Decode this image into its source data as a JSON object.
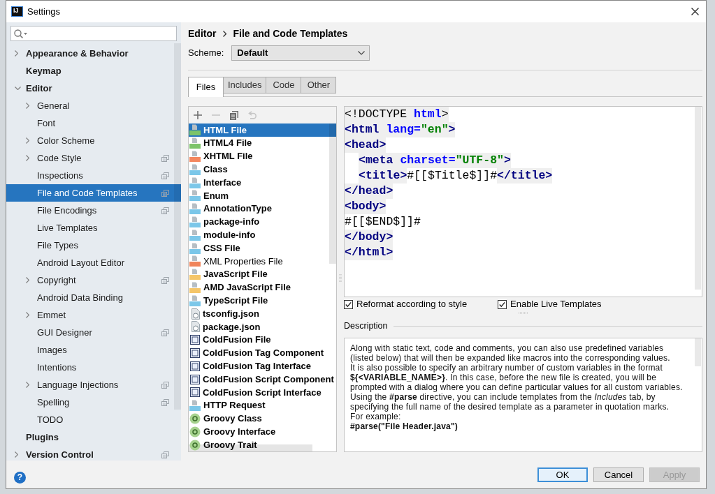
{
  "window": {
    "title": "Settings",
    "logo": "IJ"
  },
  "sidebar": {
    "items": [
      {
        "label": "Appearance & Behavior",
        "kind": "group",
        "expanded": false,
        "selected": false,
        "project_level": false
      },
      {
        "label": "Keymap",
        "kind": "leaf",
        "selected": false,
        "project_level": false
      },
      {
        "label": "Editor",
        "kind": "group",
        "expanded": true,
        "selected": false,
        "project_level": false,
        "children": [
          {
            "label": "General",
            "kind": "group",
            "expanded": false,
            "selected": false,
            "project_level": false
          },
          {
            "label": "Font",
            "kind": "leaf",
            "selected": false,
            "project_level": false
          },
          {
            "label": "Color Scheme",
            "kind": "group",
            "expanded": false,
            "selected": false,
            "project_level": false
          },
          {
            "label": "Code Style",
            "kind": "group",
            "expanded": false,
            "selected": false,
            "project_level": true
          },
          {
            "label": "Inspections",
            "kind": "leaf",
            "selected": false,
            "project_level": true
          },
          {
            "label": "File and Code Templates",
            "kind": "leaf",
            "selected": true,
            "project_level": true
          },
          {
            "label": "File Encodings",
            "kind": "leaf",
            "selected": false,
            "project_level": true
          },
          {
            "label": "Live Templates",
            "kind": "leaf",
            "selected": false,
            "project_level": false
          },
          {
            "label": "File Types",
            "kind": "leaf",
            "selected": false,
            "project_level": false
          },
          {
            "label": "Android Layout Editor",
            "kind": "leaf",
            "selected": false,
            "project_level": false
          },
          {
            "label": "Copyright",
            "kind": "group",
            "expanded": false,
            "selected": false,
            "project_level": true
          },
          {
            "label": "Android Data Binding",
            "kind": "leaf",
            "selected": false,
            "project_level": false
          },
          {
            "label": "Emmet",
            "kind": "group",
            "expanded": false,
            "selected": false,
            "project_level": false
          },
          {
            "label": "GUI Designer",
            "kind": "leaf",
            "selected": false,
            "project_level": true
          },
          {
            "label": "Images",
            "kind": "leaf",
            "selected": false,
            "project_level": false
          },
          {
            "label": "Intentions",
            "kind": "leaf",
            "selected": false,
            "project_level": false
          },
          {
            "label": "Language Injections",
            "kind": "group",
            "expanded": false,
            "selected": false,
            "project_level": true
          },
          {
            "label": "Spelling",
            "kind": "leaf",
            "selected": false,
            "project_level": true
          },
          {
            "label": "TODO",
            "kind": "leaf",
            "selected": false,
            "project_level": false
          }
        ]
      },
      {
        "label": "Plugins",
        "kind": "leaf",
        "selected": false,
        "project_level": false
      },
      {
        "label": "Version Control",
        "kind": "group",
        "expanded": false,
        "selected": false,
        "project_level": true
      }
    ]
  },
  "breadcrumb": [
    "Editor",
    "File and Code Templates"
  ],
  "scheme": {
    "label": "Scheme:",
    "value": "Default"
  },
  "tabs": [
    {
      "label": "Files",
      "selected": true
    },
    {
      "label": "Includes",
      "selected": false
    },
    {
      "label": "Code",
      "selected": false
    },
    {
      "label": "Other",
      "selected": false
    }
  ],
  "file_list": {
    "toolbar": [
      {
        "kind": "add",
        "disabled": false
      },
      {
        "kind": "remove",
        "disabled": true
      },
      {
        "kind": "copy",
        "disabled": false
      },
      {
        "kind": "reset",
        "disabled": true
      }
    ],
    "items": [
      {
        "label": "HTML File",
        "kind": "html",
        "bold": true,
        "selected": true
      },
      {
        "label": "HTML4 File",
        "kind": "html",
        "bold": true,
        "selected": false
      },
      {
        "label": "XHTML File",
        "kind": "xhtml",
        "bold": true,
        "selected": false
      },
      {
        "label": "Class",
        "kind": "java",
        "bold": true,
        "selected": false
      },
      {
        "label": "Interface",
        "kind": "java",
        "bold": true,
        "selected": false
      },
      {
        "label": "Enum",
        "kind": "java",
        "bold": true,
        "selected": false
      },
      {
        "label": "AnnotationType",
        "kind": "java",
        "bold": true,
        "selected": false
      },
      {
        "label": "package-info",
        "kind": "java",
        "bold": true,
        "selected": false
      },
      {
        "label": "module-info",
        "kind": "java",
        "bold": true,
        "selected": false
      },
      {
        "label": "CSS File",
        "kind": "css",
        "bold": true,
        "selected": false
      },
      {
        "label": "XML Properties File",
        "kind": "xml",
        "bold": false,
        "selected": false
      },
      {
        "label": "JavaScript File",
        "kind": "js",
        "bold": true,
        "selected": false
      },
      {
        "label": "AMD JavaScript File",
        "kind": "js",
        "bold": true,
        "selected": false
      },
      {
        "label": "TypeScript File",
        "kind": "ts",
        "bold": true,
        "selected": false
      },
      {
        "label": "tsconfig.json",
        "kind": "json",
        "bold": true,
        "selected": false
      },
      {
        "label": "package.json",
        "kind": "json",
        "bold": true,
        "selected": false
      },
      {
        "label": "ColdFusion File",
        "kind": "cf",
        "bold": true,
        "selected": false
      },
      {
        "label": "ColdFusion Tag Component",
        "kind": "cf",
        "bold": true,
        "selected": false
      },
      {
        "label": "ColdFusion Tag Interface",
        "kind": "cf",
        "bold": true,
        "selected": false
      },
      {
        "label": "ColdFusion Script Component",
        "kind": "cf",
        "bold": true,
        "selected": false
      },
      {
        "label": "ColdFusion Script Interface",
        "kind": "cf",
        "bold": true,
        "selected": false
      },
      {
        "label": "HTTP Request",
        "kind": "api",
        "bold": true,
        "selected": false
      },
      {
        "label": "Groovy Class",
        "kind": "groovy",
        "bold": true,
        "selected": false
      },
      {
        "label": "Groovy Interface",
        "kind": "groovy",
        "bold": true,
        "selected": false
      },
      {
        "label": "Groovy Trait",
        "kind": "groovy",
        "bold": true,
        "selected": false
      }
    ]
  },
  "editor": {
    "lines": [
      {
        "tokens": [
          {
            "text": "<!DOCTYPE ",
            "kind": "markup"
          },
          {
            "text": "html",
            "kind": "attr"
          },
          {
            "text": ">",
            "kind": "markup"
          }
        ]
      },
      {
        "tokens": [
          {
            "text": "<html ",
            "kind": "tag"
          },
          {
            "text": "lang=",
            "kind": "attr"
          },
          {
            "text": "\"en\"",
            "kind": "value"
          },
          {
            "text": ">",
            "kind": "tag"
          }
        ]
      },
      {
        "tokens": [
          {
            "text": "<head>",
            "kind": "tag"
          }
        ],
        "children": [
          {
            "tokens": [
              {
                "text": "<meta ",
                "kind": "tag"
              },
              {
                "text": "charset=",
                "kind": "attr"
              },
              {
                "text": "\"UTF-8\"",
                "kind": "value"
              },
              {
                "text": ">",
                "kind": "tag"
              }
            ]
          },
          {
            "tokens": [
              {
                "text": "<title>",
                "kind": "tag"
              },
              {
                "text": "#[[$Title$]]#",
                "kind": "text"
              },
              {
                "text": "</title>",
                "kind": "tag"
              }
            ]
          }
        ]
      },
      {
        "tokens": [
          {
            "text": "</head>",
            "kind": "tag"
          }
        ]
      },
      {
        "tokens": [
          {
            "text": "<body>",
            "kind": "tag"
          }
        ]
      },
      {
        "tokens": [
          {
            "text": "#[[$END$]]#",
            "kind": "text"
          }
        ]
      },
      {
        "tokens": [
          {
            "text": "</body>",
            "kind": "tag"
          }
        ]
      },
      {
        "tokens": [
          {
            "text": "</html>",
            "kind": "tag"
          }
        ]
      }
    ]
  },
  "options": [
    {
      "label": "Reformat according to style",
      "checked": true
    },
    {
      "label": "Enable Live Templates",
      "checked": true
    }
  ],
  "description": {
    "title": "Description",
    "paragraphs": [
      {
        "kind": "prose",
        "text": "Along with static text, code and comments, you can also use predefined variables (listed below) that will then be expanded like macros into the corresponding values."
      },
      {
        "kind": "prose",
        "text": "It is also possible to specify an arbitrary number of custom variables in the format **${<VARIABLE_NAME>}**. In this case, before the new file is created, you will be prompted with a dialog where you can define particular values for all custom variables."
      },
      {
        "kind": "prose",
        "text": "Using the **#parse** directive, you can include templates from the *Includes* tab, by specifying the full name of the desired template as a parameter in quotation marks."
      },
      {
        "kind": "prose",
        "text": "For example:"
      },
      {
        "kind": "code",
        "text": "#parse(\"File Header.java\")"
      }
    ]
  },
  "help": {
    "label": "?"
  },
  "buttons": [
    {
      "label": "OK",
      "default": true,
      "disabled": false
    },
    {
      "label": "Cancel",
      "default": false,
      "disabled": false
    },
    {
      "label": "Apply",
      "default": false,
      "disabled": true
    }
  ]
}
